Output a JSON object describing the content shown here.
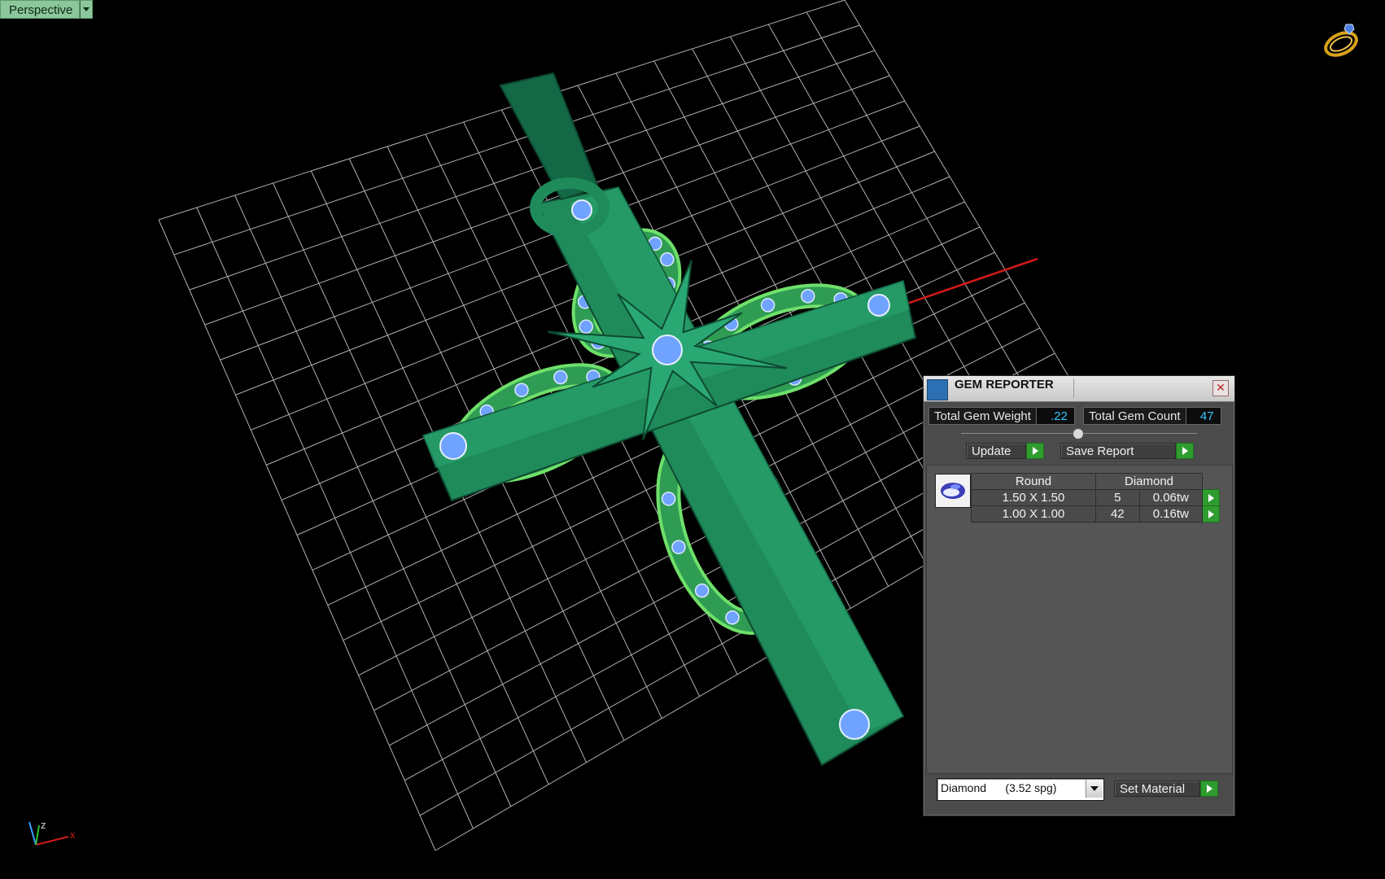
{
  "viewport": {
    "mode_label": "Perspective",
    "ring_icon": "ring-logo-icon",
    "axis_x": "x",
    "axis_z": "z",
    "colors": {
      "model": "#1f8a5a",
      "highlight": "#6fe06a",
      "gem": "#6fa3ff",
      "grid": "#d8d8d8",
      "axis_red": "#d11a1a"
    }
  },
  "gem_reporter": {
    "title": "GEM REPORTER",
    "title_icon": "gem-reporter-icon",
    "close_icon": "close-icon",
    "total_weight_label": "Total Gem Weight",
    "total_weight_value": ".22",
    "total_count_label": "Total Gem Count",
    "total_count_value": "47",
    "update_label": "Update",
    "save_report_label": "Save Report",
    "table": {
      "header_cut": "Round",
      "header_material": "Diamond",
      "rows": [
        {
          "size": "1.50 X 1.50",
          "count": "5",
          "weight": "0.06tw"
        },
        {
          "size": "1.00 X 1.00",
          "count": "42",
          "weight": "0.16tw"
        }
      ]
    },
    "material_selected": "Diamond      (3.52 spg)",
    "set_material_label": "Set Material"
  }
}
